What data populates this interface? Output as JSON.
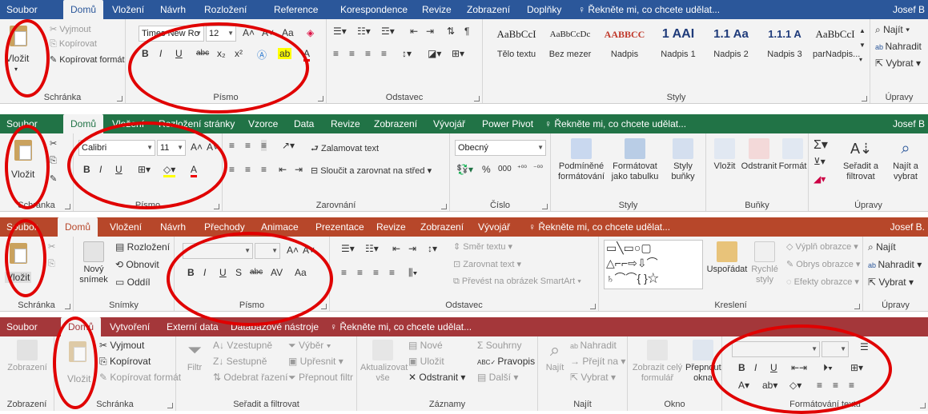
{
  "word": {
    "tabs": {
      "file": "Soubor",
      "home": "Domů",
      "insert": "Vložení",
      "design": "Návrh",
      "layout": "Rozložení",
      "references": "Reference",
      "mailings": "Korespondence",
      "review": "Revize",
      "view": "Zobrazení",
      "addins": "Doplňky"
    },
    "tell_me": "Řekněte mi, co chcete udělat...",
    "user": "Josef B",
    "clipboard": {
      "paste": "Vložit",
      "cut": "Vyjmout",
      "copy": "Kopírovat",
      "format_painter": "Kopírovat formát",
      "label": "Schránka"
    },
    "font": {
      "name": "Times New Ro",
      "size": "12",
      "label": "Písmo",
      "bold": "B",
      "italic": "I",
      "underline": "U",
      "sub": "x₂",
      "sup": "x²",
      "grow": "A˄",
      "shrink": "A˅",
      "case": "Aa"
    },
    "paragraph": {
      "label": "Odstavec"
    },
    "styles": {
      "label": "Styly",
      "items": [
        {
          "sample": "AaBbCcI",
          "name": "Tělo textu"
        },
        {
          "sample": "AaBbCcDc",
          "name": "Bez mezer"
        },
        {
          "sample": "AABBCC",
          "name": "Nadpis"
        },
        {
          "sample": "1 AAI",
          "name": "Nadpis 1"
        },
        {
          "sample": "1.1 Aa",
          "name": "Nadpis 2"
        },
        {
          "sample": "1.1.1 A",
          "name": "Nadpis 3"
        },
        {
          "sample": "AaBbCcI",
          "name": "parNadpis..."
        }
      ]
    },
    "editing": {
      "find": "Najít",
      "replace": "Nahradit",
      "select": "Vybrat",
      "label": "Úpravy"
    }
  },
  "excel": {
    "tabs": {
      "file": "Soubor",
      "home": "Domů",
      "insert": "Vložení",
      "page_layout": "Rozložení stránky",
      "formulas": "Vzorce",
      "data": "Data",
      "review": "Revize",
      "view": "Zobrazení",
      "developer": "Vývojář",
      "power_pivot": "Power Pivot"
    },
    "tell_me": "Řekněte mi, co chcete udělat...",
    "user": "Josef B",
    "clipboard": {
      "paste": "Vložit",
      "label": "Schránka"
    },
    "font": {
      "name": "Calibri",
      "size": "11",
      "label": "Písmo",
      "bold": "B",
      "italic": "I",
      "underline": "U"
    },
    "alignment": {
      "wrap": "Zalamovat text",
      "merge": "Sloučit a zarovnat na střed",
      "label": "Zarovnání"
    },
    "number": {
      "format": "Obecný",
      "percent": "%",
      "thousands": "000",
      "label": "Číslo"
    },
    "styles": {
      "conditional": "Podmíněné formátování",
      "table": "Formátovat jako tabulku",
      "cell": "Styly buňky",
      "label": "Styly"
    },
    "cells": {
      "insert": "Vložit",
      "delete": "Odstranit",
      "format": "Formát",
      "label": "Buňky"
    },
    "editing": {
      "sort": "Seřadit a filtrovat",
      "find": "Najít a vybrat",
      "label": "Úpravy"
    }
  },
  "powerpoint": {
    "tabs": {
      "file": "Soubor",
      "home": "Domů",
      "insert": "Vložení",
      "design": "Návrh",
      "transitions": "Přechody",
      "animations": "Animace",
      "slideshow": "Prezentace",
      "review": "Revize",
      "view": "Zobrazení",
      "developer": "Vývojář"
    },
    "tell_me": "Řekněte mi, co chcete udělat...",
    "user": "Josef B.",
    "clipboard": {
      "paste": "Vložit",
      "label": "Schránka"
    },
    "slides": {
      "new": "Nový snímek",
      "layout": "Rozložení",
      "reset": "Obnovit",
      "section": "Oddíl",
      "label": "Snímky"
    },
    "font": {
      "label": "Písmo",
      "bold": "B",
      "italic": "I",
      "underline": "U",
      "shadow": "S",
      "strike": "abc",
      "spacing": "AV",
      "case": "Aa"
    },
    "paragraph": {
      "direction": "Směr textu",
      "align_text": "Zarovnat text",
      "smartart": "Převést na obrázek SmartArt",
      "label": "Odstavec"
    },
    "drawing": {
      "arrange": "Uspořádat",
      "quick": "Rychlé styly",
      "fill": "Výplň obrazce",
      "outline": "Obrys obrazce",
      "effects": "Efekty obrazce",
      "label": "Kreslení"
    },
    "editing": {
      "find": "Najít",
      "replace": "Nahradit",
      "select": "Vybrat",
      "label": "Úpravy"
    }
  },
  "access": {
    "tabs": {
      "file": "Soubor",
      "home": "Domů",
      "create": "Vytvoření",
      "external": "Externí data",
      "tools": "Databázové nástroje"
    },
    "tell_me": "Řekněte mi, co chcete udělat...",
    "views": {
      "view": "Zobrazení",
      "label": "Zobrazení"
    },
    "clipboard": {
      "paste": "Vložit",
      "cut": "Vyjmout",
      "copy": "Kopírovat",
      "format_painter": "Kopírovat formát",
      "label": "Schránka"
    },
    "sort": {
      "filter": "Filtr",
      "asc": "Vzestupně",
      "desc": "Sestupně",
      "remove": "Odebrat řazení",
      "selection": "Výběr",
      "advanced": "Upřesnit",
      "toggle": "Přepnout filtr",
      "label": "Seřadit a filtrovat"
    },
    "records": {
      "refresh": "Aktualizovat vše",
      "new": "Nové",
      "save": "Uložit",
      "delete": "Odstranit",
      "totals": "Souhrny",
      "spelling": "Pravopis",
      "more": "Další",
      "label": "Záznamy"
    },
    "find": {
      "find": "Najít",
      "replace": "Nahradit",
      "goto": "Přejít na",
      "select": "Vybrat",
      "label": "Najít"
    },
    "window": {
      "fit": "Zobrazit celý formulář",
      "switch": "Přepnout okna",
      "label": "Okno"
    },
    "text_format": {
      "label": "Formátování textu",
      "bold": "B",
      "italic": "I",
      "underline": "U"
    }
  },
  "colors": {
    "word": "#2b579a",
    "excel": "#217346",
    "powerpoint": "#b7472a",
    "access": "#a4373a",
    "ring": "#e00000"
  }
}
